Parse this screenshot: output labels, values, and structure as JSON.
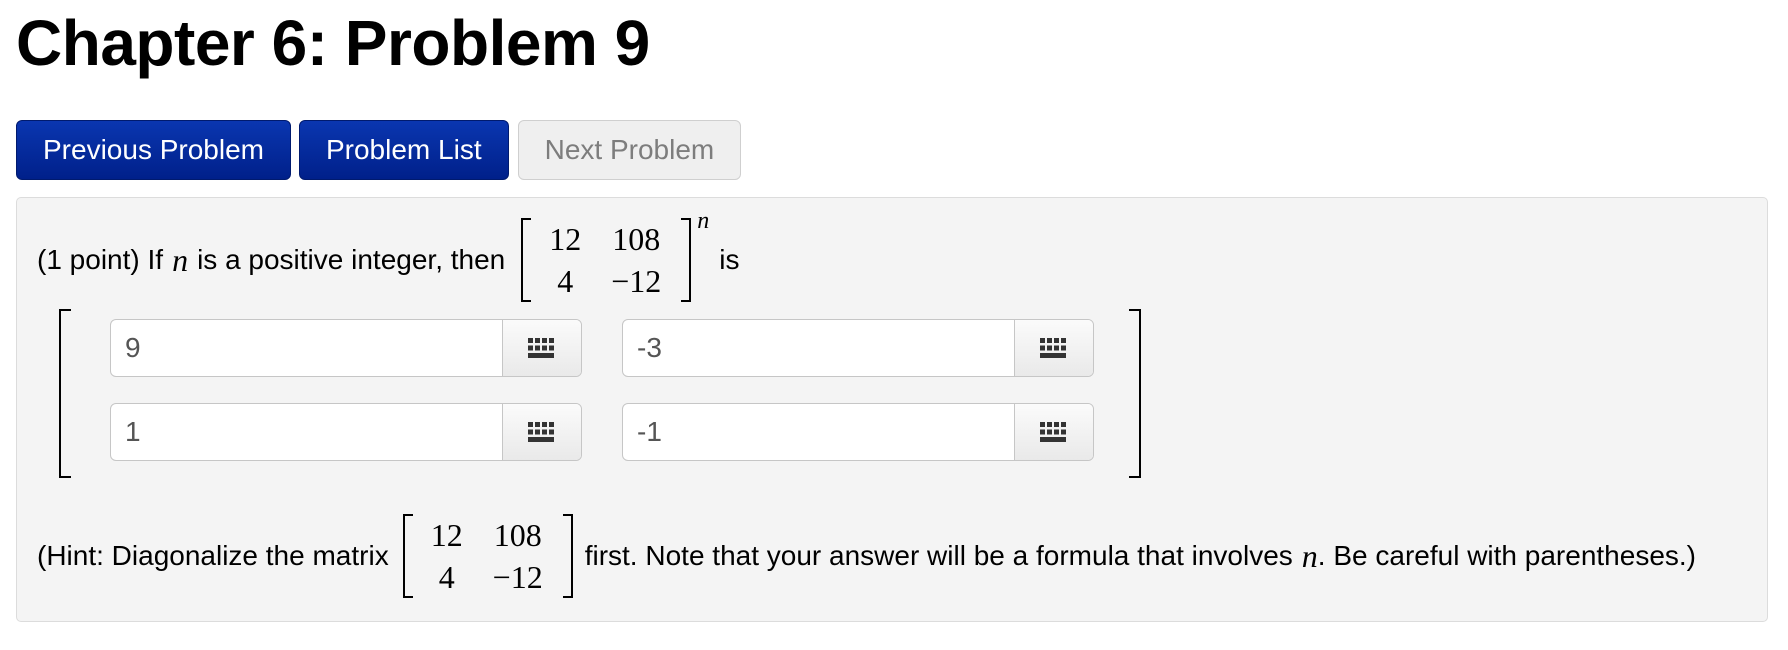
{
  "page": {
    "title": "Chapter 6: Problem 9"
  },
  "nav": {
    "previous": "Previous Problem",
    "list": "Problem List",
    "next": "Next Problem"
  },
  "problem": {
    "prefix": "(1 point) If",
    "var": "n",
    "middle": "is a positive integer, then",
    "suffix": "is",
    "matrix": [
      [
        "12",
        "108"
      ],
      [
        "4",
        "−12"
      ]
    ],
    "exponent": "n"
  },
  "answers": {
    "r1c1": "9",
    "r1c2": "-3",
    "r2c1": "1",
    "r2c2": "-1"
  },
  "hint": {
    "before": "(Hint: Diagonalize the matrix",
    "after": "first. Note that your answer will be a formula that involves",
    "var": "n",
    "end": ". Be careful with parentheses.)",
    "matrix": [
      [
        "12",
        "108"
      ],
      [
        "4",
        "−12"
      ]
    ]
  },
  "icons": {
    "keyboard": "keyboard-grid-icon"
  }
}
